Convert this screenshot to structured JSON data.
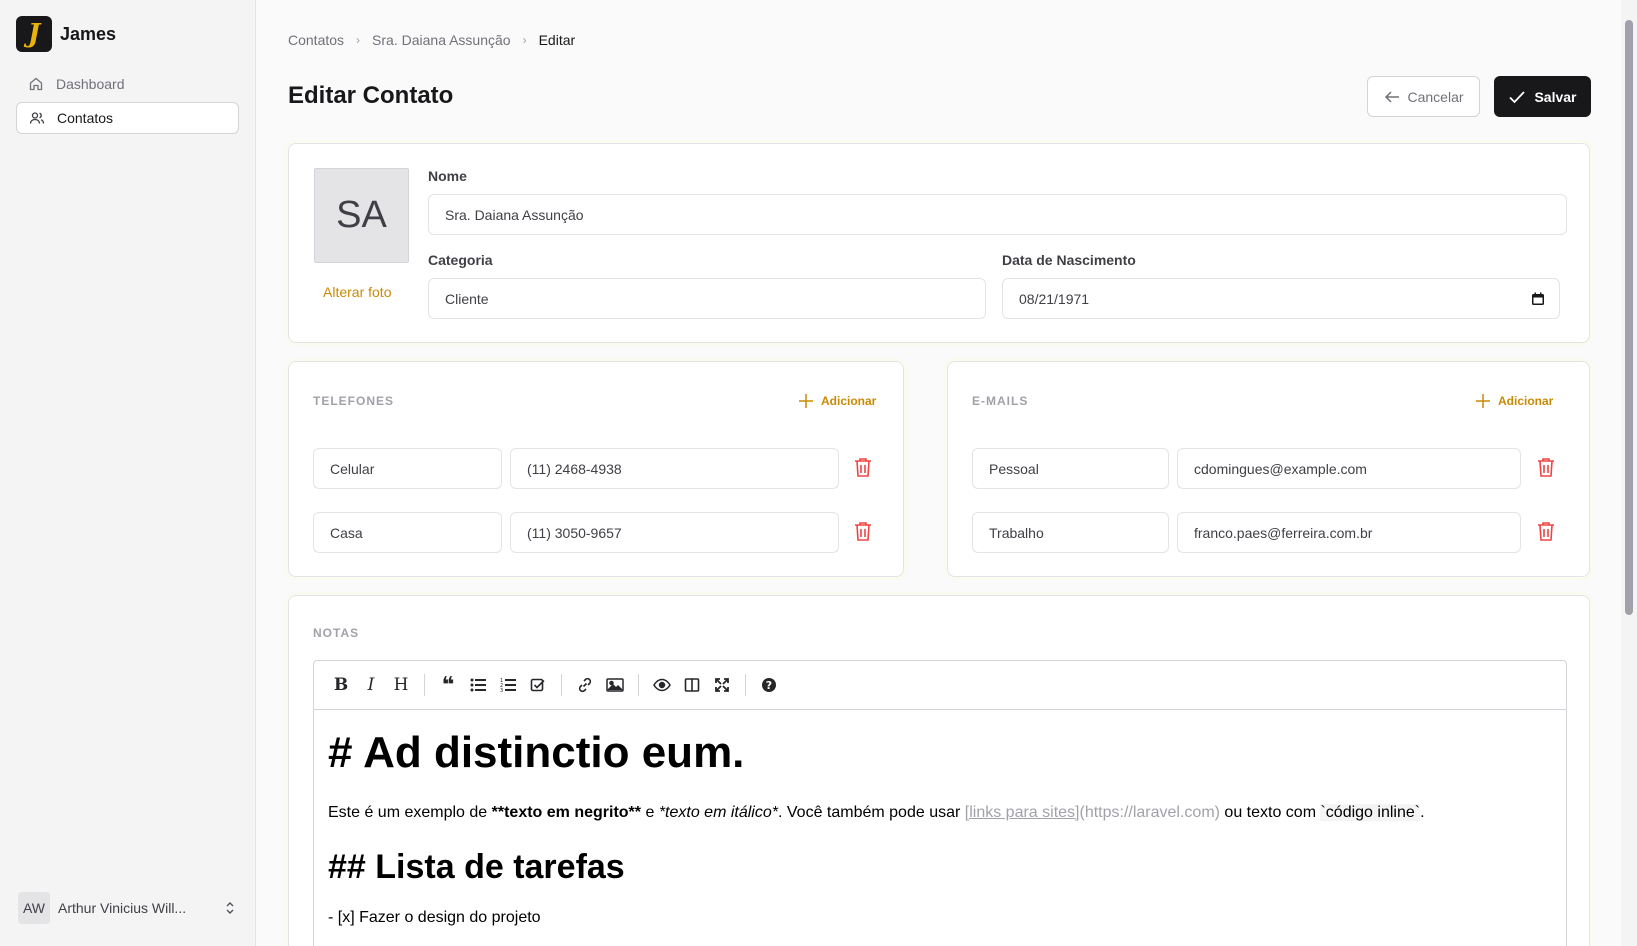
{
  "app": {
    "logo_letter": "J",
    "name": "James"
  },
  "nav": [
    {
      "label": "Dashboard",
      "icon": "home-icon"
    },
    {
      "label": "Contatos",
      "icon": "users-icon",
      "active": true
    }
  ],
  "user": {
    "initials": "AW",
    "name": "Arthur Vinicius Will..."
  },
  "breadcrumb": [
    "Contatos",
    "Sra. Daiana Assunção",
    "Editar"
  ],
  "page_title": "Editar Contato",
  "actions": {
    "cancel": "Cancelar",
    "save": "Salvar"
  },
  "profile": {
    "initials": "SA",
    "change_photo": "Alterar foto",
    "name_label": "Nome",
    "name_value": "Sra. Daiana Assunção",
    "category_label": "Categoria",
    "category_value": "Cliente",
    "birth_label": "Data de Nascimento",
    "birth_value": "08/21/1971"
  },
  "phones": {
    "title": "TELEFONES",
    "add": "Adicionar",
    "items": [
      {
        "type": "Celular",
        "value": "(11) 2468-4938"
      },
      {
        "type": "Casa",
        "value": "(11) 3050-9657"
      }
    ]
  },
  "emails": {
    "title": "E-MAILS",
    "add": "Adicionar",
    "items": [
      {
        "type": "Pessoal",
        "value": "cdomingues@example.com"
      },
      {
        "type": "Trabalho",
        "value": "franco.paes@ferreira.com.br"
      }
    ]
  },
  "notes": {
    "title": "NOTAS",
    "toolbar": [
      "bold-icon",
      "italic-icon",
      "heading-icon",
      "quote-icon",
      "unordered-list-icon",
      "ordered-list-icon",
      "checklist-icon",
      "link-icon",
      "image-icon",
      "preview-icon",
      "side-by-side-icon",
      "fullscreen-icon",
      "help-icon"
    ],
    "h1": "# Ad distinctio eum.",
    "p1": "Este é um exemplo de ",
    "p_bold": "**texto em negrito**",
    "p2": " e ",
    "p_italic": "*texto em itálico*",
    "p3": ". Você também pode usar ",
    "p_link": "[links para sites]",
    "p_url": "(https://laravel.com)",
    "p4": " ou texto com ",
    "p_code": "`código inline`",
    "p5": ".",
    "h2": "## Lista de tarefas",
    "li1": "- [x] Fazer o design do projeto"
  },
  "colors": {
    "accent": "#ca8a04",
    "danger": "#ef4444",
    "primary": "#18181b"
  }
}
